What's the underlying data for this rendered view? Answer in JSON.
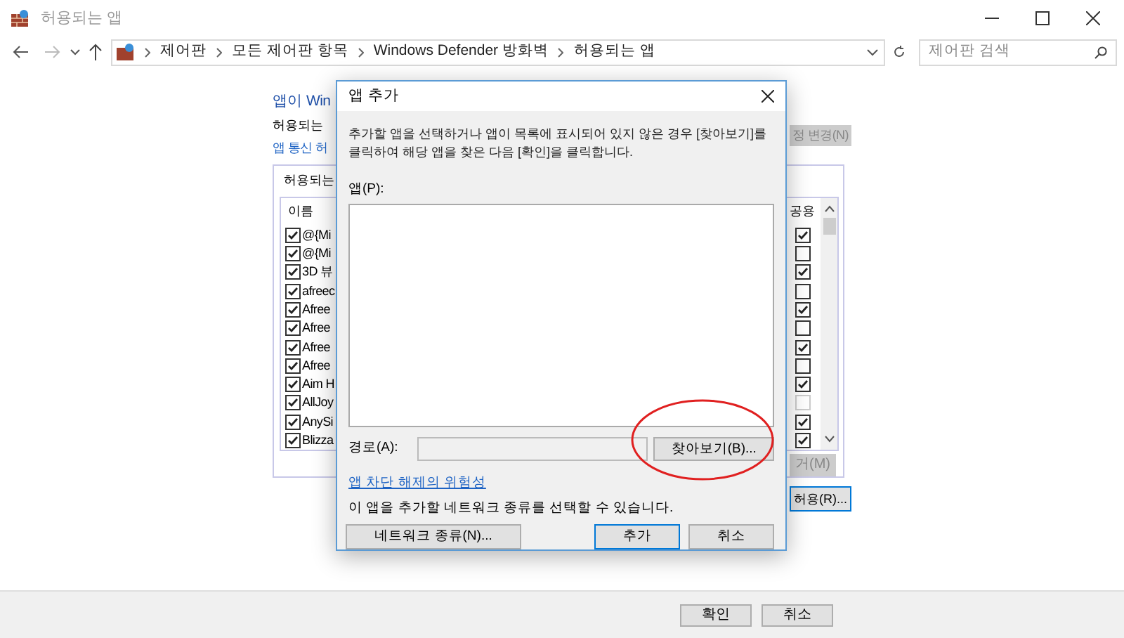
{
  "window": {
    "title": "허용되는 앱"
  },
  "address_bar": {
    "crumbs": [
      "제어판",
      "모든 제어판 항목",
      "Windows Defender 방화벽",
      "허용되는 앱"
    ],
    "search_placeholder": "제어판 검색"
  },
  "content": {
    "heading": "앱이 Win",
    "subtitle": "허용되는",
    "link": "앱 통신 허",
    "change_settings_button": {
      "label": "정 변경(N)",
      "disabled": true
    },
    "group_label": "허용되는",
    "columns": [
      "이름",
      "공용"
    ],
    "rows": [
      {
        "name": "@{Mi",
        "checked": true,
        "public": true,
        "public_disabled": false
      },
      {
        "name": "@{Mi",
        "checked": true,
        "public": false,
        "public_disabled": false
      },
      {
        "name": "3D 뷰",
        "checked": true,
        "public": true,
        "public_disabled": false
      },
      {
        "name": "afreec",
        "checked": true,
        "public": false,
        "public_disabled": false
      },
      {
        "name": "Afree",
        "checked": true,
        "public": true,
        "public_disabled": false
      },
      {
        "name": "Afree",
        "checked": true,
        "public": false,
        "public_disabled": false
      },
      {
        "name": "Afree",
        "checked": true,
        "public": true,
        "public_disabled": false
      },
      {
        "name": "Afree",
        "checked": true,
        "public": false,
        "public_disabled": false
      },
      {
        "name": "Aim H",
        "checked": true,
        "public": true,
        "public_disabled": false
      },
      {
        "name": "AllJoy",
        "checked": true,
        "public": false,
        "public_disabled": true
      },
      {
        "name": "AnySi",
        "checked": true,
        "public": true,
        "public_disabled": false
      },
      {
        "name": "Blizza",
        "checked": true,
        "public": true,
        "public_disabled": false
      }
    ],
    "remove_button": {
      "label": "거(M)",
      "disabled": true
    },
    "allow_other_button": {
      "label": "허용(R)..."
    }
  },
  "footer_buttons": [
    "확인",
    "취소"
  ],
  "dialog": {
    "title": "앱 추가",
    "description": "추가할 앱을 선택하거나 앱이 목록에 표시되어 있지 않은 경우 [찾아보기]를 클릭하여 해당 앱을 찾은 다음 [확인]을 클릭합니다.",
    "apps_label": "앱(P):",
    "path_label": "경로(A):",
    "browse_button": "찾아보기(B)...",
    "risk_link": "앱 차단 해제의 위험성",
    "network_text": "이 앱을 추가할 네트워크 종류를 선택할 수 있습니다.",
    "network_button": "네트워크 종류(N)...",
    "add_button": "추가",
    "cancel_button": "취소"
  },
  "annotation": {
    "kind": "ellipse",
    "color": "#e02020"
  }
}
